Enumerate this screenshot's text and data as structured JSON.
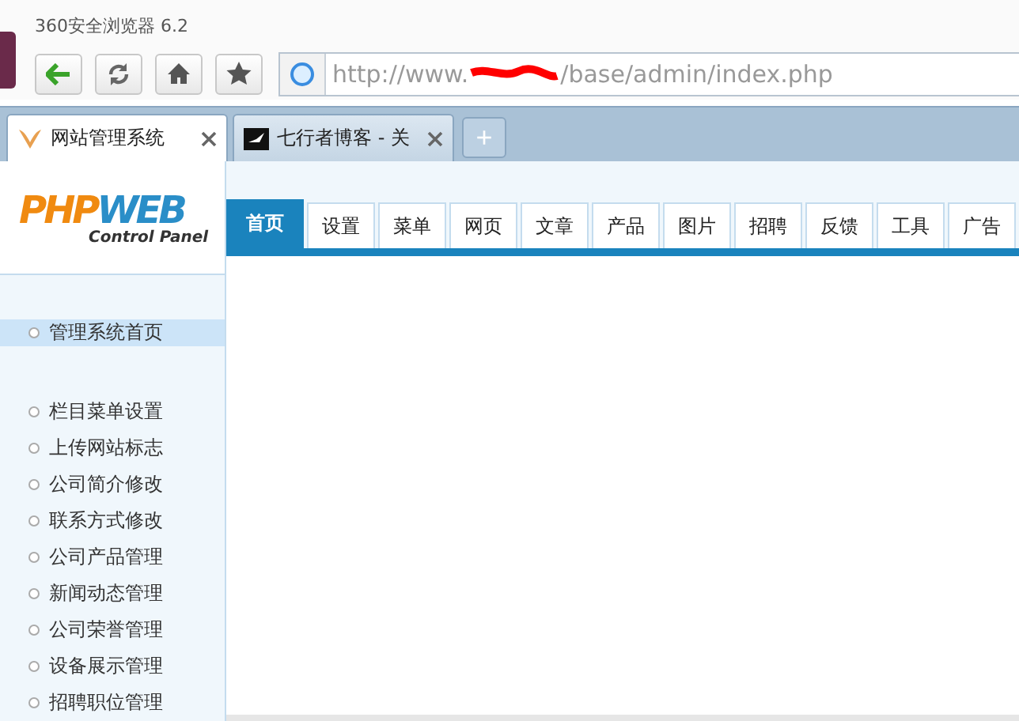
{
  "window": {
    "title": "360安全浏览器 6.2"
  },
  "address_bar": {
    "url_start": "http://www.",
    "url_end": "/base/admin/index.php"
  },
  "browser_tabs": [
    {
      "label": "网站管理系统",
      "selected": true
    },
    {
      "label": "七行者博客 - 关",
      "selected": false
    }
  ],
  "new_tab": "+",
  "logo": {
    "part_1": "PHP",
    "part_2": "WEB",
    "subtitle": "Control Panel"
  },
  "top_nav": [
    {
      "label": "首页",
      "selected": true
    },
    {
      "label": "设置",
      "selected": false
    },
    {
      "label": "菜单",
      "selected": false
    },
    {
      "label": "网页",
      "selected": false
    },
    {
      "label": "文章",
      "selected": false
    },
    {
      "label": "产品",
      "selected": false
    },
    {
      "label": "图片",
      "selected": false
    },
    {
      "label": "招聘",
      "selected": false
    },
    {
      "label": "反馈",
      "selected": false
    },
    {
      "label": "工具",
      "selected": false
    },
    {
      "label": "广告",
      "selected": false
    }
  ],
  "sidebar": {
    "home": {
      "label": "管理系统首页",
      "selected": true
    },
    "items": [
      {
        "label": "栏目菜单设置",
        "selected": false
      },
      {
        "label": "上传网站标志",
        "selected": false
      },
      {
        "label": "公司简介修改",
        "selected": false
      },
      {
        "label": "联系方式修改",
        "selected": false
      },
      {
        "label": "公司产品管理",
        "selected": false
      },
      {
        "label": "新闻动态管理",
        "selected": false
      },
      {
        "label": "公司荣誉管理",
        "selected": false
      },
      {
        "label": "设备展示管理",
        "selected": false
      },
      {
        "label": "招聘职位管理",
        "selected": false
      }
    ]
  }
}
